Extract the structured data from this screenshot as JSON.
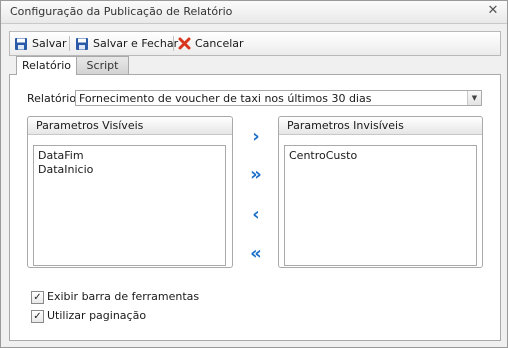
{
  "window": {
    "title": "Configuração da Publicação de Relatório",
    "close_icon": "close-icon"
  },
  "toolbar": {
    "save_label": "Salvar",
    "save_close_label": "Salvar e Fechar",
    "cancel_label": "Cancelar"
  },
  "tabs": [
    {
      "label": "Relatório",
      "active": true
    },
    {
      "label": "Script",
      "active": false
    }
  ],
  "report": {
    "label": "Relatório:",
    "selected": "Fornecimento de voucher de taxi nos últimos 30 dias"
  },
  "visible_params": {
    "title": "Parametros Visíveis",
    "items": [
      "DataFim",
      "DataInicio"
    ]
  },
  "invisible_params": {
    "title": "Parametros Invisíveis",
    "items": [
      "CentroCusto"
    ]
  },
  "move_buttons": {
    "right": "›",
    "all_right": "»",
    "left": "‹",
    "all_left": "«"
  },
  "options": {
    "toolbar_label": "Exibir barra de ferramentas",
    "toolbar_checked": true,
    "paging_label": "Utilizar paginação",
    "paging_checked": true
  },
  "colors": {
    "accent_blue": "#1a6fc9",
    "cancel_red": "#d9361e",
    "save_blue": "#2a5aa8"
  }
}
